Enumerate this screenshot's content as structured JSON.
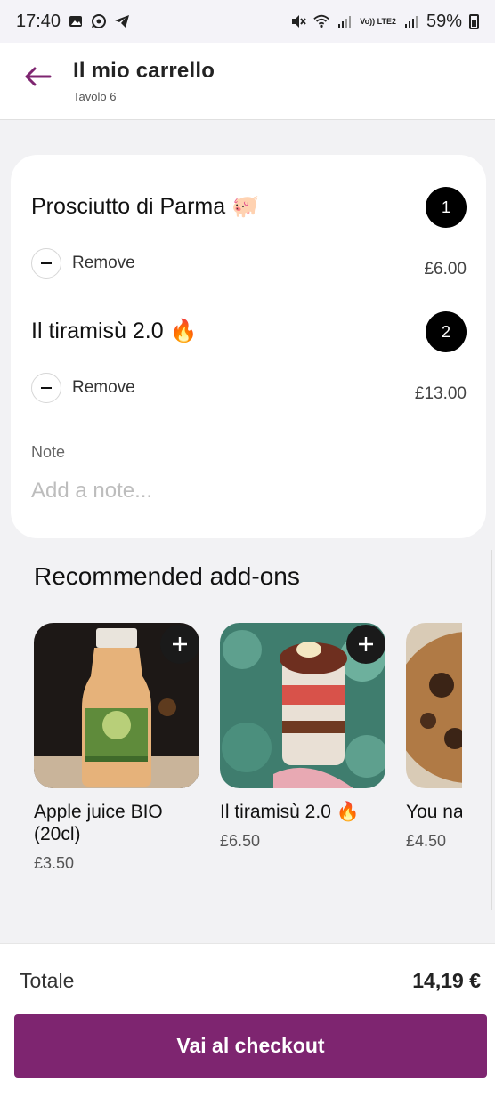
{
  "status_bar": {
    "time": "17:40",
    "battery": "59%",
    "network_label": "Vo)) LTE2"
  },
  "header": {
    "title": "Il mio carrello",
    "subtitle": "Tavolo 6"
  },
  "cart": {
    "items": [
      {
        "name": "Prosciutto di Parma 🐖",
        "quantity": "1",
        "remove_label": "Remove",
        "price": "£6.00"
      },
      {
        "name": "Il tiramisù 2.0 🔥",
        "quantity": "2",
        "remove_label": "Remove",
        "price": "£13.00"
      }
    ],
    "note_label": "Note",
    "note_placeholder": "Add a note..."
  },
  "recommended": {
    "title": "Recommended add-ons",
    "items": [
      {
        "name": "Apple juice BIO (20cl)",
        "price": "£3.50"
      },
      {
        "name": "Il tiramisù 2.0 🔥",
        "price": "£6.50"
      },
      {
        "name": "You name it cookie",
        "price": "£4.50"
      }
    ]
  },
  "footer": {
    "total_label": "Totale",
    "total_value": "14,19 €",
    "checkout_label": "Vai al checkout"
  },
  "colors": {
    "accent": "#7e2570",
    "badge": "#000000",
    "background": "#f2f2f4"
  }
}
